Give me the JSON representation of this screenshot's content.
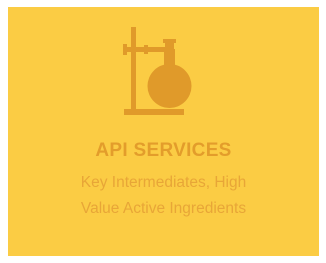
{
  "card": {
    "icon": "chemistry-flask-on-stand-icon",
    "title": "API SERVICES",
    "subtitle_lines": [
      "Key Intermediates, High",
      "Value Active Ingredients"
    ]
  },
  "colors": {
    "background": "#fbcc44",
    "accent": "#e39d2b",
    "icon": "#e09a2a"
  }
}
